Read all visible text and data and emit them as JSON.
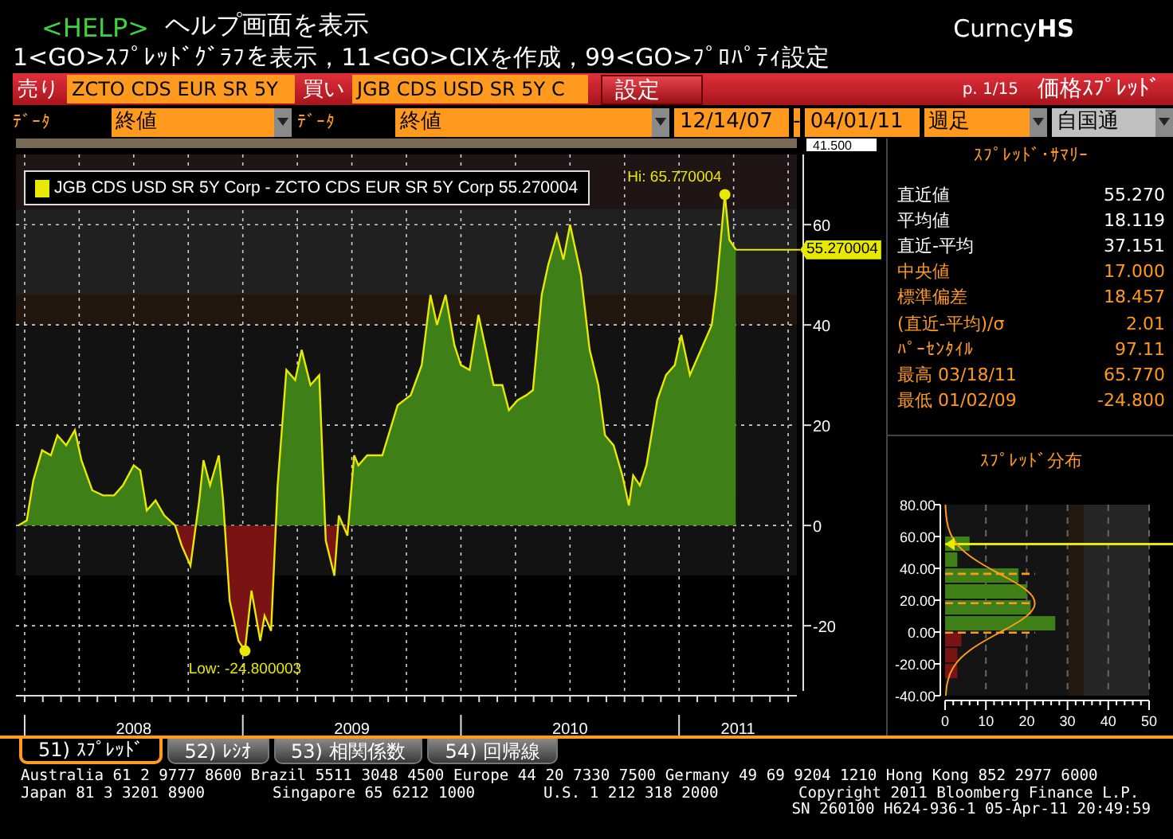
{
  "header": {
    "help_command": "<HELP>",
    "help_text": "ヘルプ画面を表示",
    "market": "Curncy**HS**",
    "command_line": "1<GO>ｽﾌﾟﾚｯﾄﾞｸﾞﾗﾌを表示，11<GO>CIXを作成，99<GO>ﾌﾟﾛﾊﾟﾃｨ設定"
  },
  "security_bar": {
    "sell_label": "売り",
    "sell_security": "ZCTO CDS EUR SR 5Y",
    "buy_label": "買い",
    "buy_security": "JGB CDS USD SR 5Y C",
    "settings_button": "設定",
    "page": "p. 1/15",
    "screen_title": "価格ｽﾌﾟﾚｯﾄﾞ"
  },
  "options_bar": {
    "data_label_1": "ﾃﾞｰﾀ",
    "data_value_1": "終値",
    "data_label_2": "ﾃﾞｰﾀ",
    "data_value_2": "終値",
    "start_date": "12/14/07",
    "date_separator": "-",
    "end_date": "04/01/11",
    "period": "週足",
    "currency": "自国通"
  },
  "chart": {
    "overview_value": "41.500",
    "legend_value": "55.270004",
    "price_tag": "55.270004",
    "chart_data": {
      "type": "area",
      "grid": true,
      "xlim": [
        2007.96,
        2011.54
      ],
      "ylim": [
        -33,
        74
      ],
      "yticks": [
        -20,
        0,
        20,
        40,
        60
      ],
      "xticks": [
        {
          "value": 2008.5,
          "label": "2008"
        },
        {
          "value": 2009.5,
          "label": "2009"
        },
        {
          "value": 2010.5,
          "label": "2010"
        },
        {
          "value": 2011.27,
          "label": "2011"
        }
      ],
      "x": [
        2007.97,
        2008.01,
        2008.04,
        2008.08,
        2008.12,
        2008.15,
        2008.19,
        2008.23,
        2008.26,
        2008.31,
        2008.36,
        2008.41,
        2008.45,
        2008.5,
        2008.53,
        2008.56,
        2008.6,
        2008.64,
        2008.69,
        2008.72,
        2008.76,
        2008.8,
        2008.82,
        2008.85,
        2008.89,
        2008.91,
        2008.94,
        2008.98,
        2009.01,
        2009.04,
        2009.08,
        2009.1,
        2009.13,
        2009.16,
        2009.2,
        2009.24,
        2009.27,
        2009.31,
        2009.35,
        2009.38,
        2009.42,
        2009.44,
        2009.48,
        2009.51,
        2009.53,
        2009.57,
        2009.64,
        2009.71,
        2009.77,
        2009.82,
        2009.86,
        2009.89,
        2009.93,
        2009.97,
        2010.0,
        2010.04,
        2010.08,
        2010.12,
        2010.15,
        2010.19,
        2010.22,
        2010.26,
        2010.3,
        2010.33,
        2010.37,
        2010.4,
        2010.44,
        2010.47,
        2010.5,
        2010.55,
        2010.59,
        2010.63,
        2010.66,
        2010.7,
        2010.74,
        2010.77,
        2010.79,
        2010.82,
        2010.85,
        2010.9,
        2010.94,
        2010.98,
        2011.01,
        2011.05,
        2011.08,
        2011.12,
        2011.15,
        2011.17,
        2011.21,
        2011.23,
        2011.26
      ],
      "series": [
        {
          "name": "JGB CDS USD SR 5Y Corp - ZCTO CDS EUR SR 5Y Corp",
          "color": "#e8e800",
          "values": [
            0,
            1,
            9,
            15,
            14,
            18,
            16,
            19,
            13,
            7,
            6,
            6,
            8,
            12,
            11,
            3,
            5,
            2,
            0,
            -4,
            -8,
            5,
            13,
            8,
            14,
            5,
            -15,
            -23,
            -25,
            -13,
            -23,
            -18,
            -21,
            8,
            31,
            29,
            35,
            28,
            30,
            -3,
            -10,
            2,
            -2,
            14,
            12,
            14,
            14,
            24,
            26,
            32,
            46,
            40,
            46,
            36,
            32,
            31,
            42,
            34,
            28,
            28,
            23,
            25,
            26,
            27,
            46,
            52,
            58,
            53,
            60,
            50,
            35,
            28,
            18,
            16,
            10,
            4,
            10,
            8,
            12,
            25,
            30,
            32,
            38,
            30,
            33,
            37,
            40,
            47,
            66,
            57,
            55
          ]
        }
      ],
      "annotations": [
        {
          "x": 2011.21,
          "y": 66,
          "text": "Hi: 65.770004"
        },
        {
          "x": 2009.01,
          "y": -25,
          "text": "Low: -24.800003"
        }
      ]
    }
  },
  "summary": {
    "title": "ｽﾌﾟﾚｯﾄﾞ･ｻﾏﾘｰ",
    "rows": [
      {
        "label": "直近値",
        "value": "55.270",
        "color": "#ffffff"
      },
      {
        "label": "平均値",
        "value": "18.119",
        "color": "#ffffff"
      },
      {
        "label": "直近-平均",
        "value": "37.151",
        "color": "#ffffff"
      },
      {
        "label": "中央値",
        "value": "17.000",
        "color": "#ff9a1e"
      },
      {
        "label": "標準偏差",
        "value": "18.457",
        "color": "#ff9a1e"
      },
      {
        "label": "(直近-平均)/σ",
        "value": "2.01",
        "color": "#ff9a1e"
      },
      {
        "label": "ﾊﾟｰｾﾝﾀｲﾙ",
        "value": "97.11",
        "color": "#ff9a1e"
      },
      {
        "label": "最高 03/18/11",
        "value": "65.770",
        "color": "#ff9a1e"
      },
      {
        "label": "最低 01/02/09",
        "value": "-24.800",
        "color": "#ff9a1e"
      }
    ]
  },
  "distribution": {
    "title": "ｽﾌﾟﾚｯﾄﾞ分布",
    "chart_data": {
      "type": "bar",
      "orientation": "horizontal",
      "grid": true,
      "x": [
        55,
        45,
        35,
        25,
        15,
        5,
        -5,
        -15,
        -25
      ],
      "values": [
        6,
        3,
        18,
        20,
        21,
        27,
        4,
        3,
        3
      ],
      "xlim": [
        0,
        50
      ],
      "ylim": [
        -40,
        80
      ],
      "xticks": [
        0,
        10,
        20,
        30,
        40,
        50
      ],
      "yticks": [
        {
          "value": -40,
          "label": "-40.00"
        },
        {
          "value": -20,
          "label": "-20.00"
        },
        {
          "value": 0,
          "label": "0.00"
        },
        {
          "value": 20,
          "label": "20.00"
        },
        {
          "value": 40,
          "label": "40.00"
        },
        {
          "value": 60,
          "label": "60.00"
        },
        {
          "value": 80,
          "label": "80.00"
        }
      ],
      "ref_lines": [
        {
          "axis": "y",
          "value": 55.27,
          "color": "#e8e800"
        },
        {
          "axis": "y",
          "value": 36.58,
          "color": "#ff9a1e"
        },
        {
          "axis": "y",
          "value": 18.12,
          "color": "#ff9a1e"
        },
        {
          "axis": "y",
          "value": -0.34,
          "color": "#ff9a1e"
        }
      ]
    }
  },
  "tabs": [
    {
      "label": "51) ｽﾌﾟﾚｯﾄﾞ",
      "selected": true
    },
    {
      "label": "52) ﾚｼｵ",
      "selected": false
    },
    {
      "label": "53) 相関係数",
      "selected": false
    },
    {
      "label": "54) 回帰線",
      "selected": false
    }
  ],
  "footer": {
    "line_1": "Australia 61 2 9777 8600 Brazil 5511 3048 4500 Europe 44 20 7330 7500 Germany 49 69 9204 1210 Hong Kong 852 2977 6000",
    "japan": "Japan 81 3 3201 8900",
    "singapore": "Singapore 65 6212 1000",
    "us": "U.S. 1 212 318 2000",
    "copyright": "Copyright 2011 Bloomberg Finance L.P.",
    "session": "SN 260100 H624-936-1 05-Apr-11 20:49:59"
  }
}
